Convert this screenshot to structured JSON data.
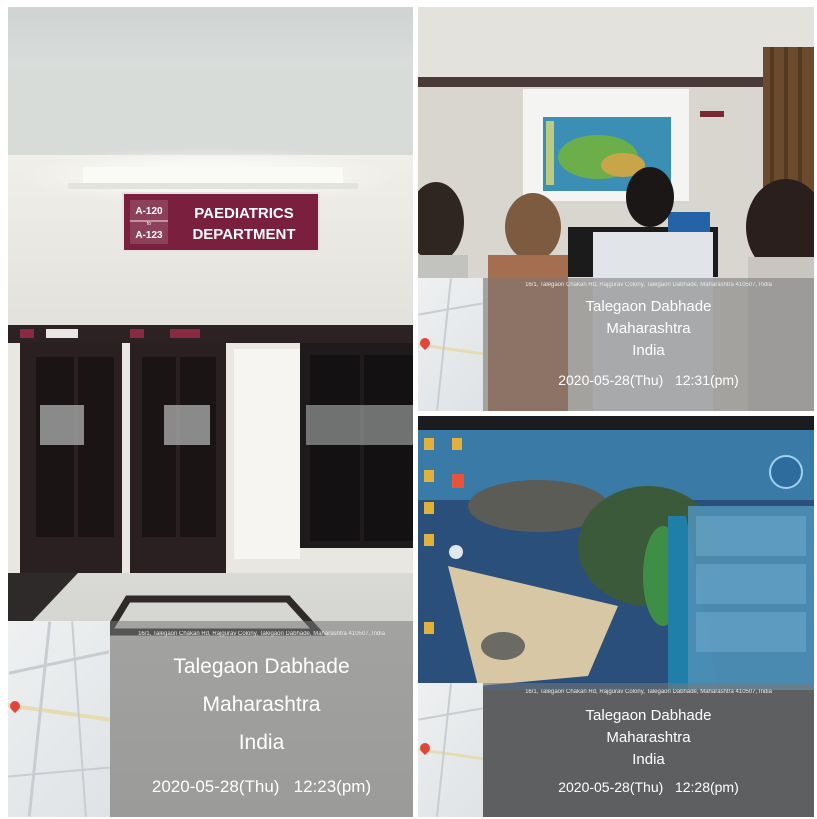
{
  "photos": [
    {
      "sign": {
        "room_from": "A-120",
        "room_to": "A-123",
        "to_word": "to",
        "line1": "PAEDIATRICS",
        "line2": "DEPARTMENT"
      },
      "stamp": {
        "address": "16/1, Talegaon Chakan Rd, Rajgurav Colony, Talegaon Dabhade, Maharashtra 410507, India",
        "city": "Talegaon Dabhade",
        "state": "Maharashtra",
        "country": "India",
        "datetime": "2020-05-28(Thu)   12:23(pm)"
      }
    },
    {
      "stamp": {
        "address": "16/1, Talegaon Chakan Rd, Rajgurav Colony, Talegaon Dabhade, Maharashtra 410507, India",
        "city": "Talegaon Dabhade",
        "state": "Maharashtra",
        "country": "India",
        "datetime": "2020-05-28(Thu)   12:31(pm)"
      }
    },
    {
      "stamp": {
        "address": "16/1, Talegaon Chakan Rd, Rajgurav Colony, Talegaon Dabhade, Maharashtra 410507, India",
        "city": "Talegaon Dabhade",
        "state": "Maharashtra",
        "country": "India",
        "datetime": "2020-05-28(Thu)   12:28(pm)"
      }
    }
  ]
}
